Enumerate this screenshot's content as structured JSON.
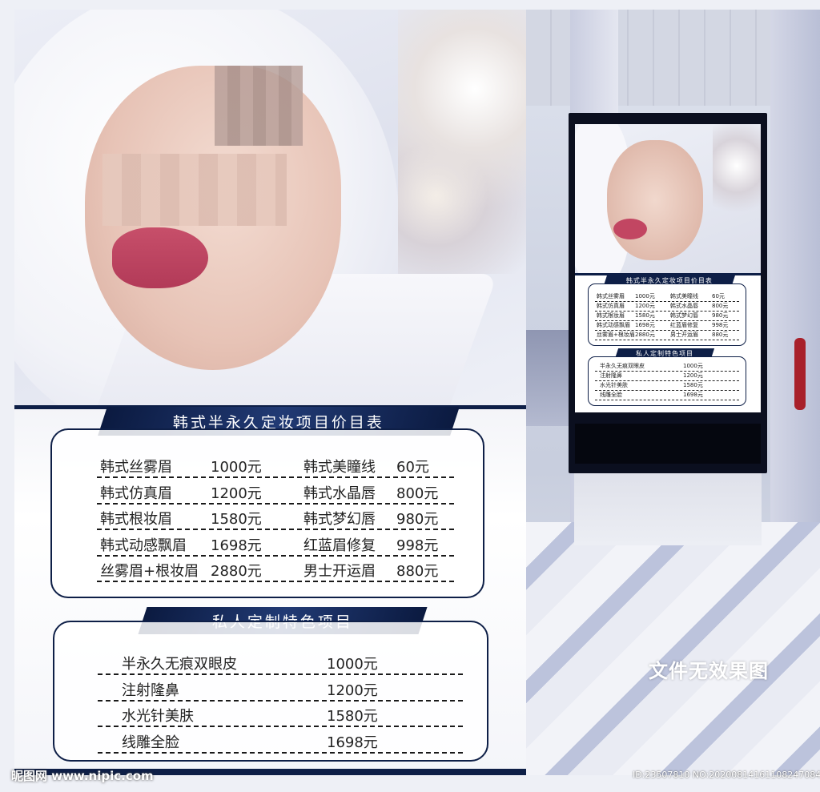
{
  "price_table": {
    "title": "韩式半永久定妆项目价目表",
    "rows": [
      {
        "left_name": "韩式丝雾眉",
        "left_price": "1000元",
        "right_name": "韩式美瞳线",
        "right_price": "60元"
      },
      {
        "left_name": "韩式仿真眉",
        "left_price": "1200元",
        "right_name": "韩式水晶唇",
        "right_price": "800元"
      },
      {
        "left_name": "韩式根妆眉",
        "left_price": "1580元",
        "right_name": "韩式梦幻唇",
        "right_price": "980元"
      },
      {
        "left_name": "韩式动感飘眉",
        "left_price": "1698元",
        "right_name": "红蓝眉修复",
        "right_price": "998元"
      },
      {
        "left_name": "丝雾眉+根妆眉",
        "left_price": "2880元",
        "right_name": "男士开运眉",
        "right_price": "880元"
      }
    ]
  },
  "custom_table": {
    "title": "私人定制特色项目",
    "rows": [
      {
        "name": "半永久无痕双眼皮",
        "price": "1000元"
      },
      {
        "name": "注射隆鼻",
        "price": "1200元"
      },
      {
        "name": "水光针美肤",
        "price": "1580元"
      },
      {
        "name": "线雕全脸",
        "price": "1698元"
      }
    ]
  },
  "effect_note": "文件无效果图",
  "watermark_left": "昵图网 www.nipic.com",
  "watermark_right": "ID:23507810 NO:20200814161108247084",
  "colors": {
    "navy": "#0e1f47",
    "lip": "#c24662"
  }
}
